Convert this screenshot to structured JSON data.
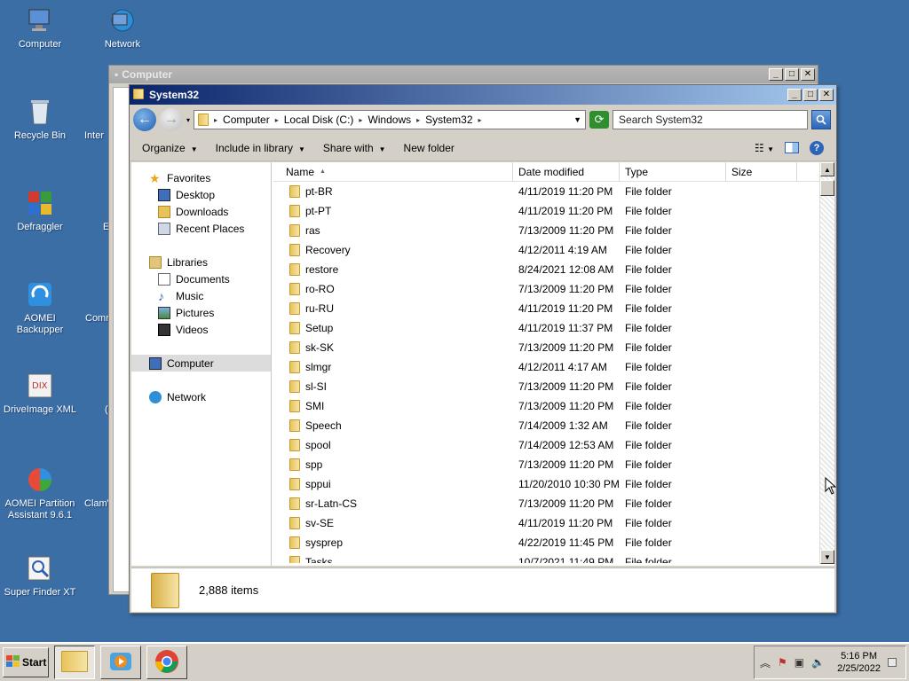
{
  "desktop": {
    "icons": [
      {
        "label": "Computer"
      },
      {
        "label": "Network"
      },
      {
        "label": "Recycle Bin"
      },
      {
        "label": "Inter"
      },
      {
        "label": "Defraggler"
      },
      {
        "label": "E"
      },
      {
        "label": "AOMEI Backupper"
      },
      {
        "label": "Comm"
      },
      {
        "label": "DriveImage XML"
      },
      {
        "label": "("
      },
      {
        "label": "AOMEI Partition Assistant 9.6.1"
      },
      {
        "label": "ClamV"
      },
      {
        "label": "Super Finder XT"
      }
    ]
  },
  "bg_window": {
    "title": "Computer"
  },
  "window": {
    "title": "System32",
    "breadcrumb": [
      "Computer",
      "Local Disk (C:)",
      "Windows",
      "System32"
    ],
    "search_placeholder": "Search System32",
    "toolbar": {
      "organize": "Organize",
      "include": "Include in library",
      "share": "Share with",
      "new_folder": "New folder"
    },
    "nav": {
      "favorites": "Favorites",
      "desktop": "Desktop",
      "downloads": "Downloads",
      "recent": "Recent Places",
      "libraries": "Libraries",
      "documents": "Documents",
      "music": "Music",
      "pictures": "Pictures",
      "videos": "Videos",
      "computer": "Computer",
      "network": "Network"
    },
    "columns": {
      "name": "Name",
      "date": "Date modified",
      "type": "Type",
      "size": "Size"
    },
    "files": [
      {
        "name": "pt-BR",
        "date": "4/11/2019 11:20 PM",
        "type": "File folder"
      },
      {
        "name": "pt-PT",
        "date": "4/11/2019 11:20 PM",
        "type": "File folder"
      },
      {
        "name": "ras",
        "date": "7/13/2009 11:20 PM",
        "type": "File folder"
      },
      {
        "name": "Recovery",
        "date": "4/12/2011 4:19 AM",
        "type": "File folder"
      },
      {
        "name": "restore",
        "date": "8/24/2021 12:08 AM",
        "type": "File folder"
      },
      {
        "name": "ro-RO",
        "date": "7/13/2009 11:20 PM",
        "type": "File folder"
      },
      {
        "name": "ru-RU",
        "date": "4/11/2019 11:20 PM",
        "type": "File folder"
      },
      {
        "name": "Setup",
        "date": "4/11/2019 11:37 PM",
        "type": "File folder"
      },
      {
        "name": "sk-SK",
        "date": "7/13/2009 11:20 PM",
        "type": "File folder"
      },
      {
        "name": "slmgr",
        "date": "4/12/2011 4:17 AM",
        "type": "File folder"
      },
      {
        "name": "sl-SI",
        "date": "7/13/2009 11:20 PM",
        "type": "File folder"
      },
      {
        "name": "SMI",
        "date": "7/13/2009 11:20 PM",
        "type": "File folder"
      },
      {
        "name": "Speech",
        "date": "7/14/2009 1:32 AM",
        "type": "File folder"
      },
      {
        "name": "spool",
        "date": "7/14/2009 12:53 AM",
        "type": "File folder"
      },
      {
        "name": "spp",
        "date": "7/13/2009 11:20 PM",
        "type": "File folder"
      },
      {
        "name": "sppui",
        "date": "11/20/2010 10:30 PM",
        "type": "File folder"
      },
      {
        "name": "sr-Latn-CS",
        "date": "7/13/2009 11:20 PM",
        "type": "File folder"
      },
      {
        "name": "sv-SE",
        "date": "4/11/2019 11:20 PM",
        "type": "File folder"
      },
      {
        "name": "sysprep",
        "date": "4/22/2019 11:45 PM",
        "type": "File folder"
      },
      {
        "name": "Tasks",
        "date": "10/7/2021 11:49 PM",
        "type": "File folder"
      }
    ],
    "status": "2,888 items"
  },
  "taskbar": {
    "start": "Start",
    "time": "5:16 PM",
    "date": "2/25/2022"
  }
}
